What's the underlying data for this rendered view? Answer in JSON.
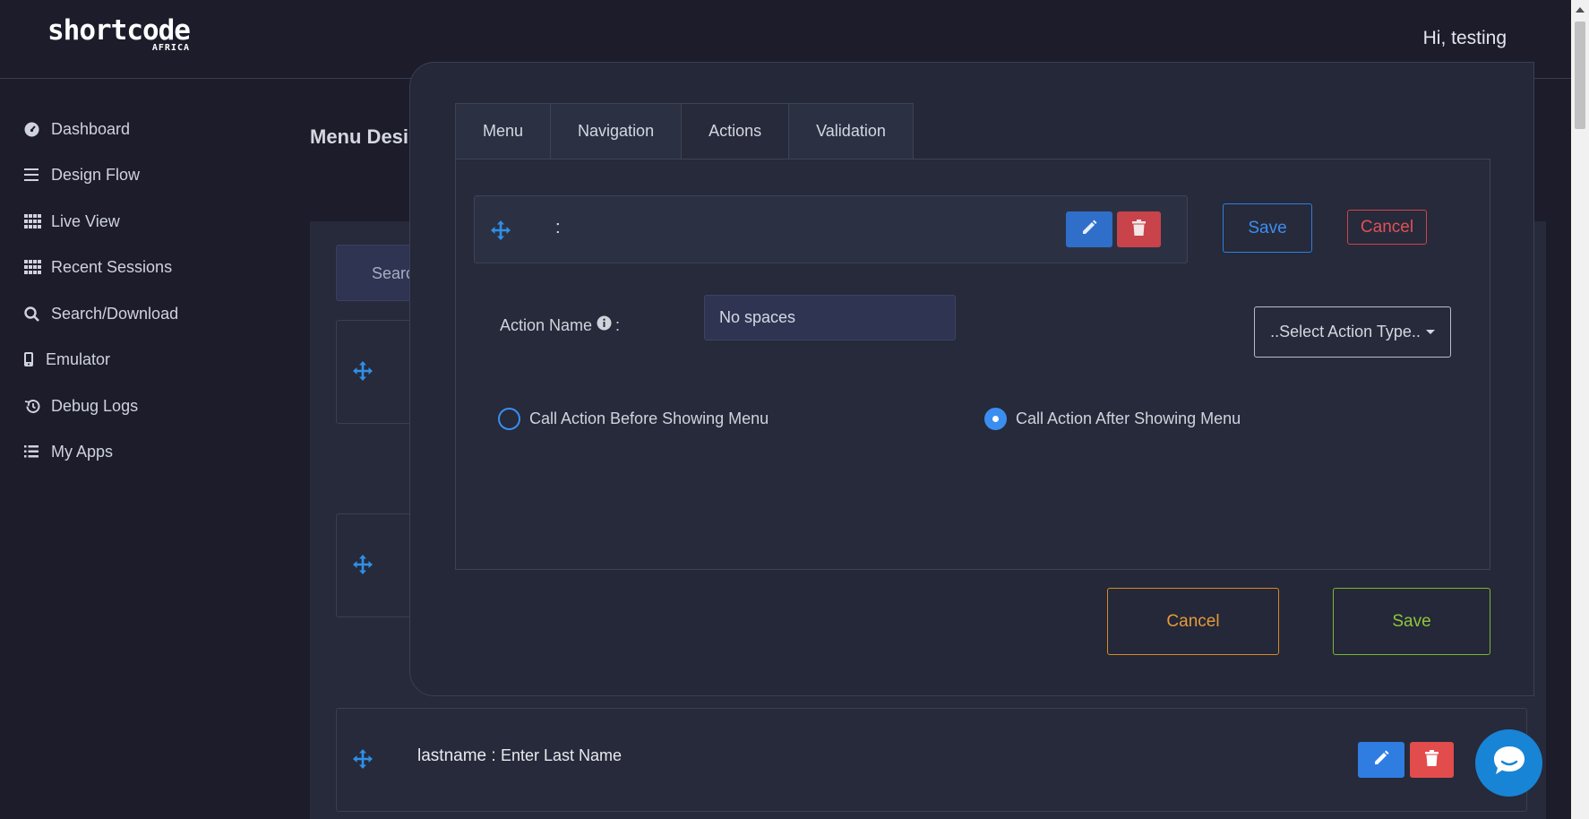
{
  "header": {
    "brand": "shortcode",
    "brand_sub": "AFRICA",
    "greeting": "Hi, testing"
  },
  "sidebar": {
    "items": [
      {
        "label": "Dashboard",
        "icon": "dashboard-icon"
      },
      {
        "label": "Design Flow",
        "icon": "menu-lines-icon"
      },
      {
        "label": "Live View",
        "icon": "grid-dots-icon"
      },
      {
        "label": "Recent Sessions",
        "icon": "grid-dots-icon"
      },
      {
        "label": "Search/Download",
        "icon": "search-icon"
      },
      {
        "label": "Emulator",
        "icon": "mobile-icon"
      },
      {
        "label": "Debug Logs",
        "icon": "history-icon"
      },
      {
        "label": "My Apps",
        "icon": "list-icon"
      }
    ]
  },
  "page": {
    "title": "Menu Desi",
    "search_label": "Searc",
    "row": {
      "name": "lastname",
      "separator": " : ",
      "value": "Enter Last Name"
    }
  },
  "modal": {
    "tabs": [
      {
        "label": "Menu",
        "active": false
      },
      {
        "label": "Navigation",
        "active": false
      },
      {
        "label": "Actions",
        "active": true
      },
      {
        "label": "Validation",
        "active": false
      }
    ],
    "action_row": {
      "text": ":"
    },
    "save_label": "Save",
    "cancel_label": "Cancel",
    "action_name_label": "Action Name",
    "action_name_colon": ":",
    "action_name_placeholder": "No spaces",
    "select_label": "..Select Action Type..",
    "radio_before": {
      "label": "Call Action Before Showing Menu",
      "checked": false
    },
    "radio_after": {
      "label": "Call Action After Showing Menu",
      "checked": true
    },
    "footer_cancel": "Cancel",
    "footer_save": "Save"
  },
  "colors": {
    "accent_blue": "#2f7de1",
    "danger_red": "#e24c4c",
    "warning_orange": "#e39a3c",
    "success_green": "#8fc53e"
  }
}
